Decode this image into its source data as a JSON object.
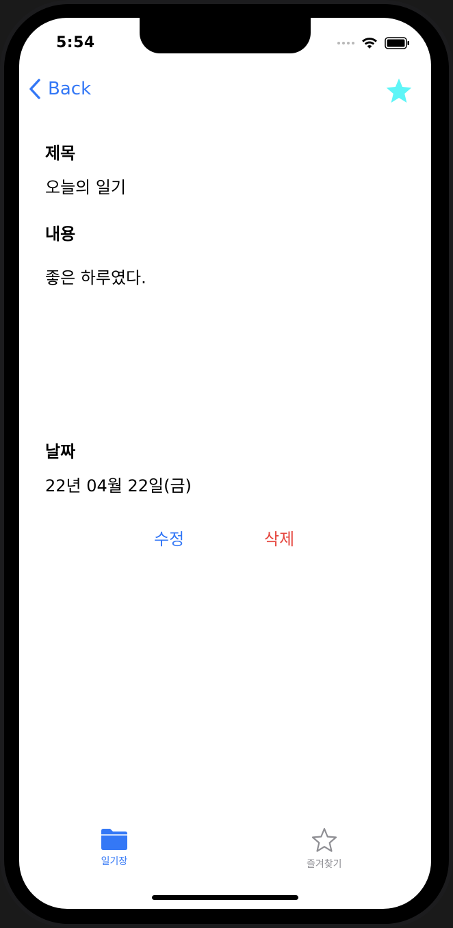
{
  "status_bar": {
    "time": "5:54"
  },
  "nav": {
    "back_label": "Back",
    "favorite_color": "#5ef5f7"
  },
  "form": {
    "title_label": "제목",
    "title_value": "오늘의 일기",
    "content_label": "내용",
    "content_value": "좋은 하루였다.",
    "date_label": "날짜",
    "date_value": "22년 04월 22일(금)"
  },
  "actions": {
    "edit_label": "수정",
    "edit_color": "#3478f6",
    "delete_label": "삭제",
    "delete_color": "#e5473f"
  },
  "tab_bar": {
    "items": [
      {
        "label": "일기장",
        "icon": "folder-icon",
        "active": true
      },
      {
        "label": "즐겨찾기",
        "icon": "star-outline-icon",
        "active": false
      }
    ],
    "active_color": "#3478f6",
    "inactive_color": "#8e8e93"
  }
}
